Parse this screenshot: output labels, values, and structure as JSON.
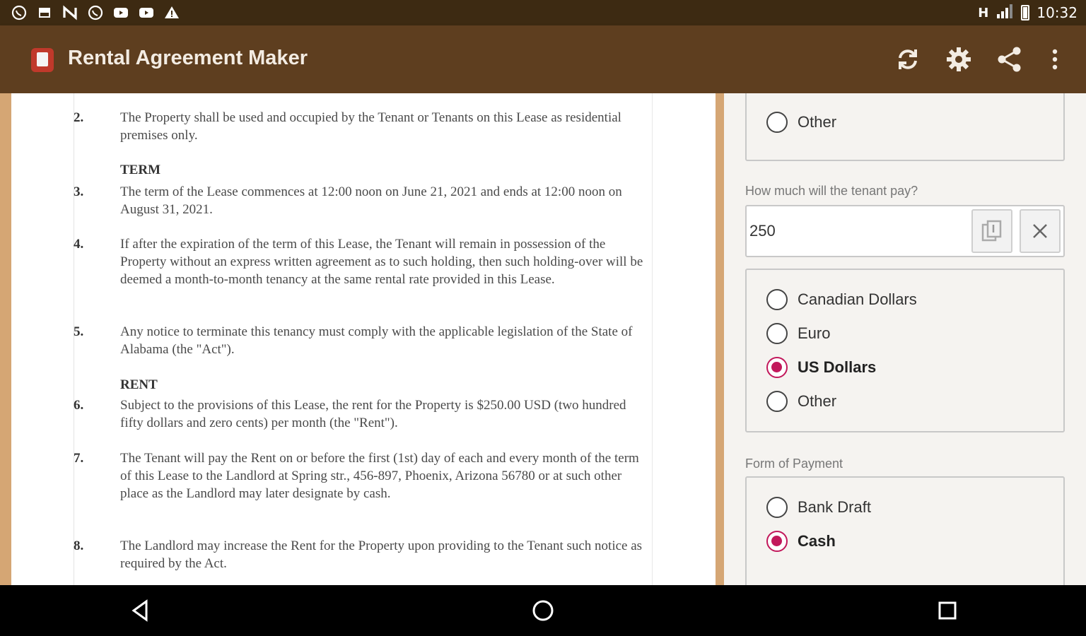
{
  "status_bar": {
    "time": "10:32",
    "network": "H",
    "notification_icons": [
      "whatsapp-icon",
      "image-icon",
      "n-icon",
      "whatsapp-icon",
      "youtube-icon",
      "youtube-icon",
      "warning-icon"
    ]
  },
  "app_bar": {
    "title": "Rental Agreement Maker",
    "actions": [
      "refresh-icon",
      "settings-icon",
      "share-icon",
      "more-icon"
    ]
  },
  "document": {
    "sections": [
      {
        "heading": ""
      },
      {
        "heading": "TERM"
      },
      {
        "heading": "RENT"
      }
    ],
    "paragraphs": [
      {
        "num": "2.",
        "text": "The Property shall be used and occupied by the Tenant or Tenants on this Lease as residential premises only."
      },
      {
        "num": "3.",
        "text": "The term of the Lease commences at 12:00 noon on June 21, 2021 and ends at 12:00 noon on August 31, 2021."
      },
      {
        "num": "4.",
        "text": "If after the expiration of the term of this Lease, the Tenant will remain in possession of the Property without an express written agreement as to such holding, then such holding-over will be deemed a month-to-month tenancy at the same rental rate provided in this Lease."
      },
      {
        "num": "5.",
        "text": "Any notice to terminate this tenancy must comply with the applicable legislation of the State of Alabama (the \"Act\")."
      },
      {
        "num": "6.",
        "text": "Subject to the provisions of this Lease, the rent for the Property is $250.00 USD (two hundred fifty dollars and zero cents) per month (the \"Rent\")."
      },
      {
        "num": "7.",
        "text": "The Tenant will pay the Rent on or before the first (1st) day of each and every month of the term of this Lease to the Landlord at Spring str., 456-897, Phoenix, Arizona 56780 or at such other place as the Landlord may later designate by cash."
      },
      {
        "num": "8.",
        "text": "The Landlord may increase the Rent for the Property upon providing to the Tenant such notice as required by the Act."
      }
    ]
  },
  "form": {
    "top_group": {
      "options": [
        {
          "label": "Other",
          "selected": false
        }
      ]
    },
    "amount": {
      "label": "How much will the tenant pay?",
      "value": "250"
    },
    "currency": {
      "options": [
        {
          "label": "Canadian Dollars",
          "selected": false
        },
        {
          "label": "Euro",
          "selected": false
        },
        {
          "label": "US Dollars",
          "selected": true
        },
        {
          "label": "Other",
          "selected": false
        }
      ]
    },
    "payment": {
      "label": "Form of Payment",
      "options": [
        {
          "label": "Bank Draft",
          "selected": false
        },
        {
          "label": "Cash",
          "selected": true
        }
      ]
    }
  },
  "colors": {
    "status_bar": "#3d2a12",
    "app_bar": "#5e3e1f",
    "accent_border": "#d5a674",
    "radio_selected": "#c2185b"
  },
  "nav_bar": {
    "buttons": [
      "back-icon",
      "home-icon",
      "recents-icon"
    ]
  }
}
